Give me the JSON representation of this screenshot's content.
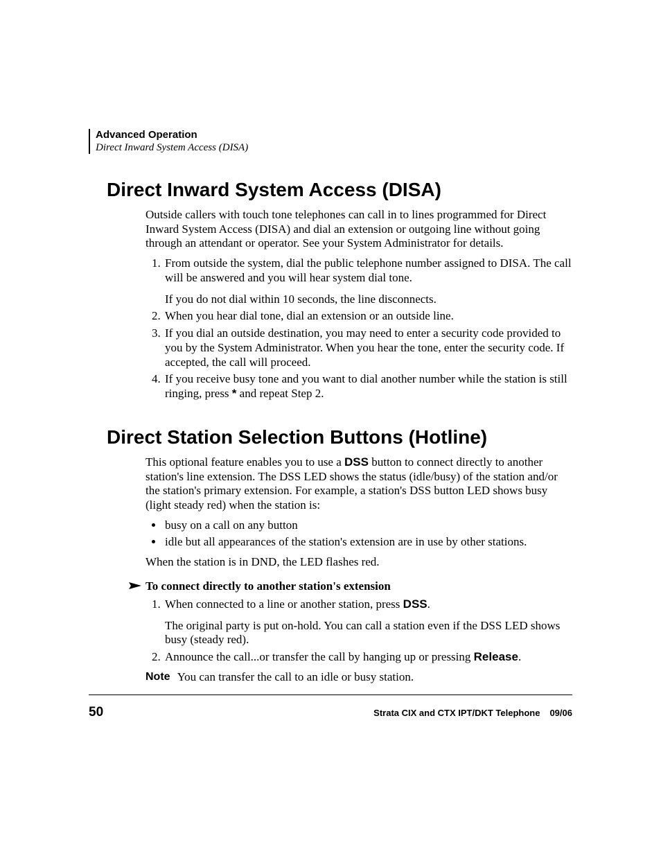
{
  "header": {
    "line1": "Advanced Operation",
    "line2": "Direct Inward System Access (DISA)"
  },
  "section1": {
    "title": "Direct Inward System Access (DISA)",
    "intro": "Outside callers with touch tone telephones can call in to lines programmed for Direct Inward System Access (DISA) and dial an extension or outgoing line without going through an attendant or operator. See your System Administrator for details.",
    "steps": [
      {
        "text": "From outside the system, dial the public telephone number assigned to DISA. The call will be answered and you will hear system dial tone.",
        "sub": "If you do not dial within 10 seconds, the line disconnects."
      },
      {
        "text": "When you hear dial tone, dial an extension or an outside line."
      },
      {
        "text": "If you dial an outside destination, you may need to enter a security code provided to you by the System Administrator. When you hear the tone, enter the security code. If accepted, the call will proceed."
      },
      {
        "pre": "If you receive busy tone and you want to dial another number while the station is still ringing, press ",
        "star": "*",
        "post": " and repeat Step 2."
      }
    ]
  },
  "section2": {
    "title": "Direct Station Selection Buttons (Hotline)",
    "intro_pre": "This optional feature enables you to use a ",
    "intro_bold": "DSS",
    "intro_post": " button to connect directly to another station's line extension. The DSS LED shows the status (idle/busy) of the station and/or the station's primary extension. For example, a station's DSS button LED shows busy (light steady red) when the station is:",
    "bullets": [
      "busy on a call on any button",
      "idle but all appearances of the station's extension are in use by other stations."
    ],
    "after_bullets": "When the station is in DND, the LED flashes red.",
    "proc_title": "To connect directly to another station's extension",
    "proc_steps": [
      {
        "pre": "When connected to a line or another station, press ",
        "bold": "DSS",
        "post": ".",
        "sub": "The original party is put on-hold. You can call a station even if the DSS LED shows busy (steady red)."
      },
      {
        "pre": "Announce the call...or transfer the call by hanging up or pressing ",
        "bold": "Release",
        "post": "."
      }
    ],
    "note_label": "Note",
    "note_text": "You can transfer the call to an idle or busy station."
  },
  "footer": {
    "page": "50",
    "title": "Strata CIX and CTX IPT/DKT Telephone",
    "date": "09/06"
  }
}
